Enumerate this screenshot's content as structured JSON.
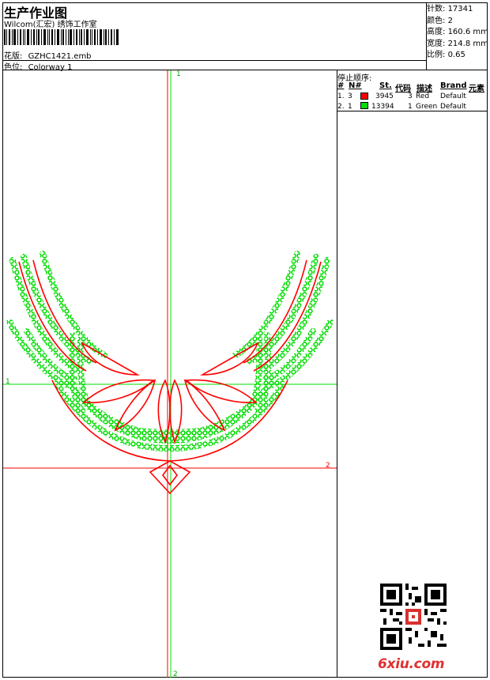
{
  "header": {
    "title": "生产作业图",
    "subtitle": "Wilcom(汇宏) 绣饰工作室",
    "pattern_label": "花版:",
    "pattern_value": "GZHC1421.emb",
    "colorway_label": "色位:",
    "colorway_value": "Colorway 1"
  },
  "stats": [
    {
      "label": "针数:",
      "value": "17341"
    },
    {
      "label": "颜色:",
      "value": "2"
    },
    {
      "label": "高度:",
      "value": "160.6 mm"
    },
    {
      "label": "宽度:",
      "value": "214.8 mm"
    },
    {
      "label": "比例:",
      "value": "0.65"
    }
  ],
  "sequence": {
    "title": "停止顺序:",
    "headers": [
      "#",
      "N#",
      "St.",
      "代码",
      "描述",
      "Brand",
      "元素"
    ],
    "rows": [
      {
        "idx": "1.",
        "n": "3",
        "color": "#ff0000",
        "st": "3945",
        "code": "3",
        "desc": "Red",
        "brand": "Default"
      },
      {
        "idx": "2.",
        "n": "1",
        "color": "#00dd00",
        "st": "13394",
        "code": "1",
        "desc": "Green",
        "brand": "Default"
      }
    ]
  },
  "guides": {
    "v_top": "1",
    "h_green": "1",
    "h_red": "2",
    "v_bottom": "2",
    "green_color": "#00dd00",
    "red_color": "#ff0000"
  },
  "footer": {
    "brand": "6xiu.com",
    "brand_color": "#e03030"
  }
}
